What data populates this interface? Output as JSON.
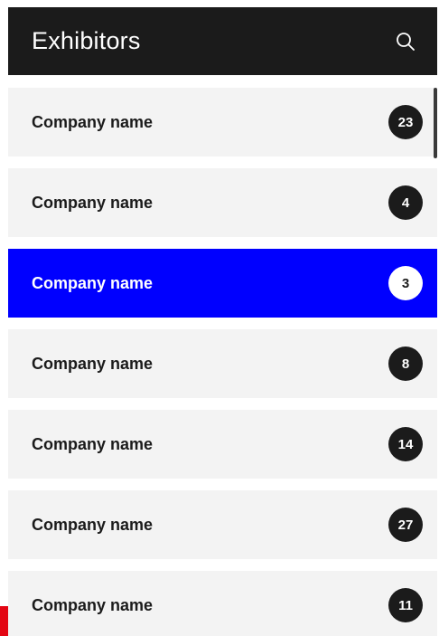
{
  "header": {
    "title": "Exhibitors",
    "search_icon": "search-icon"
  },
  "exhibitors": [
    {
      "name": "Company name",
      "count": "23",
      "active": false
    },
    {
      "name": "Company name",
      "count": "4",
      "active": false
    },
    {
      "name": "Company name",
      "count": "3",
      "active": true
    },
    {
      "name": "Company name",
      "count": "8",
      "active": false
    },
    {
      "name": "Company name",
      "count": "14",
      "active": false
    },
    {
      "name": "Company name",
      "count": "27",
      "active": false
    },
    {
      "name": "Company name",
      "count": "11",
      "active": false
    }
  ],
  "colors": {
    "header_bg": "#1b1b1b",
    "row_bg": "#f3f3f3",
    "active_bg": "#0000ff",
    "badge_bg": "#1b1b1b",
    "accent_tab": "#e30613"
  }
}
